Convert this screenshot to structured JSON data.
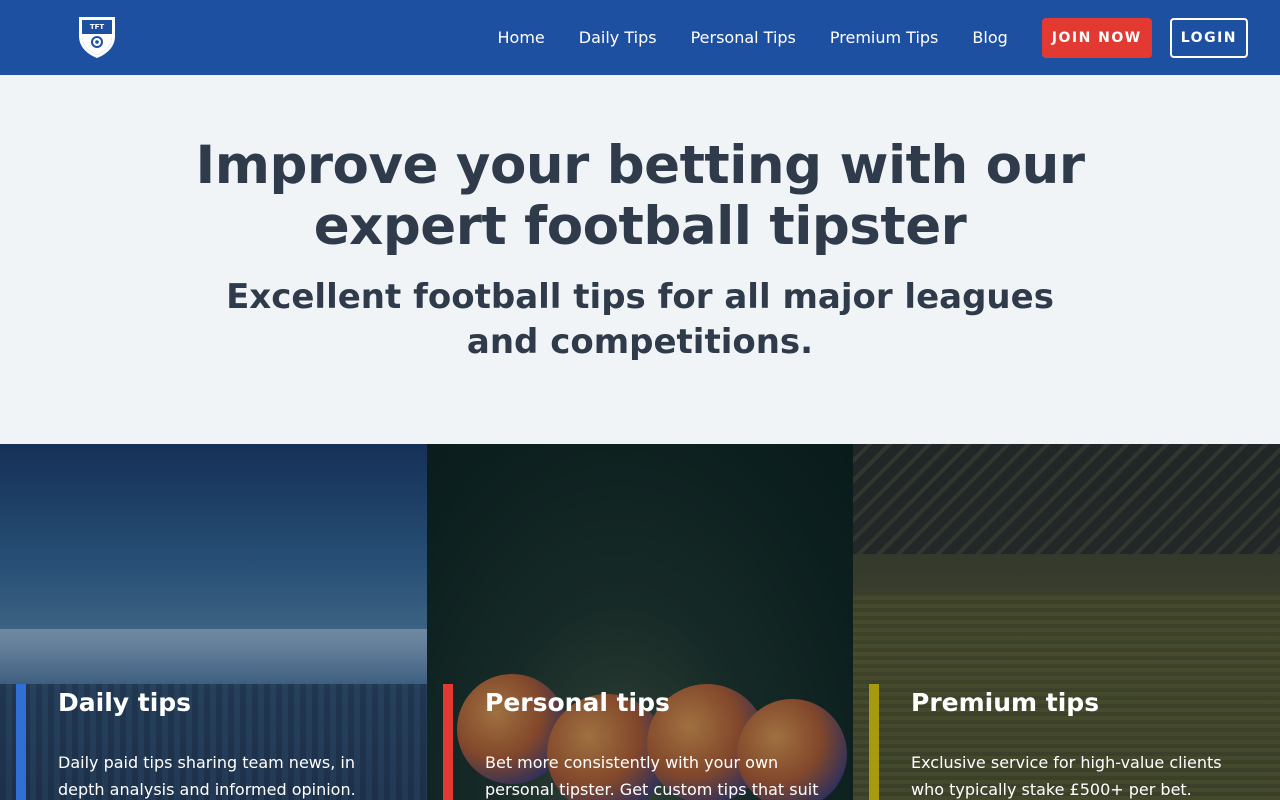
{
  "header": {
    "logo_text": "TFT",
    "nav": [
      "Home",
      "Daily Tips",
      "Personal Tips",
      "Premium Tips",
      "Blog"
    ],
    "join_label": "JOIN NOW",
    "login_label": "LOGIN"
  },
  "hero": {
    "title": "Improve your betting with our expert football tipster",
    "subtitle": "Excellent football tips for all major leagues and competitions."
  },
  "cards": [
    {
      "title": "Daily tips",
      "text": "Daily paid tips sharing team news, in depth analysis and informed opinion.",
      "accent": "#2f6fd6"
    },
    {
      "title": "Personal tips",
      "text": "Bet more consistently with your own personal tipster. Get custom tips that suit your style of",
      "accent": "#e23a33"
    },
    {
      "title": "Premium tips",
      "text": "Exclusive service for high-value clients who typically stake £500+ per bet.",
      "accent": "#a89a10"
    }
  ],
  "colors": {
    "header_bg": "#1e50a2",
    "join_bg": "#e23a33",
    "page_bg": "#f0f4f7",
    "text_dark": "#2f3b4a"
  }
}
